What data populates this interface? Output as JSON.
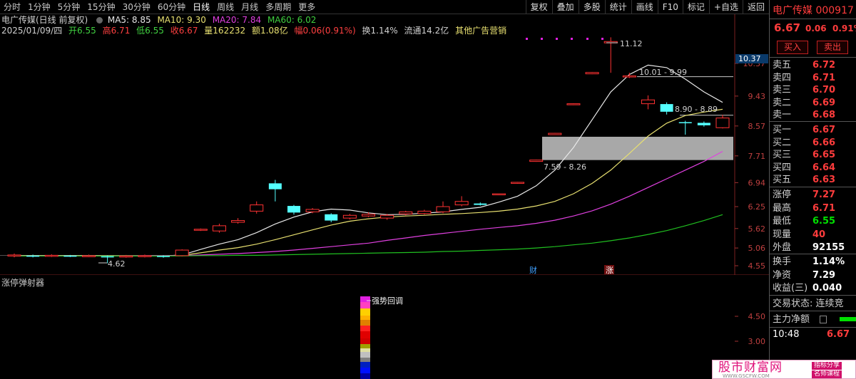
{
  "toolbar": {
    "periods": [
      "分时",
      "1分钟",
      "5分钟",
      "15分钟",
      "30分钟",
      "60分钟",
      "日线",
      "周线",
      "月线",
      "多周期",
      "更多"
    ],
    "active_period": "日线",
    "actions": [
      "复权",
      "叠加",
      "多股",
      "统计",
      "画线",
      "F10",
      "标记",
      "+自选",
      "返回"
    ]
  },
  "info": {
    "title": "电广传媒(日线 前复权)",
    "ma5": "MA5: 8.85",
    "ma10": "MA10: 9.30",
    "ma20": "MA20: 7.84",
    "ma60": "MA60: 6.02",
    "date": "2025/01/09/四",
    "open": "开6.55",
    "high": "高6.71",
    "low": "低6.55",
    "close": "收6.67",
    "volume": "量162232",
    "amount": "额1.08亿",
    "change": "幅0.06(0.91%)",
    "turnover": "换1.14%",
    "float": "流通14.2亿",
    "sector": "其他广告营销"
  },
  "chart_data": {
    "type": "candlestick",
    "yaxis_ticks": [
      "10.37",
      "9.43",
      "8.57",
      "7.71",
      "6.94",
      "6.25",
      "5.62",
      "5.06",
      "4.55"
    ],
    "current_price_label": "10.37",
    "candles": [
      {
        "o": 4.83,
        "c": 4.86,
        "h": 4.9,
        "l": 4.79
      },
      {
        "o": 4.84,
        "c": 4.82,
        "h": 4.87,
        "l": 4.79
      },
      {
        "o": 4.82,
        "c": 4.85,
        "h": 4.88,
        "l": 4.8
      },
      {
        "o": 4.84,
        "c": 4.83,
        "h": 4.86,
        "l": 4.8
      },
      {
        "o": 4.83,
        "c": 4.84,
        "h": 4.87,
        "l": 4.8
      },
      {
        "o": 4.82,
        "c": 4.8,
        "h": 4.84,
        "l": 4.62
      },
      {
        "o": 4.8,
        "c": 4.83,
        "h": 4.86,
        "l": 4.78
      },
      {
        "o": 4.82,
        "c": 4.84,
        "h": 4.87,
        "l": 4.79
      },
      {
        "o": 4.83,
        "c": 4.81,
        "h": 4.85,
        "l": 4.78
      },
      {
        "o": 4.84,
        "c": 5.0,
        "h": 5.02,
        "l": 4.82
      },
      {
        "o": 5.57,
        "c": 5.6,
        "h": 5.62,
        "l": 5.55
      },
      {
        "o": 5.55,
        "c": 5.7,
        "h": 5.76,
        "l": 5.5
      },
      {
        "o": 5.8,
        "c": 5.85,
        "h": 5.92,
        "l": 5.76
      },
      {
        "o": 6.12,
        "c": 6.3,
        "h": 6.4,
        "l": 6.05
      },
      {
        "o": 6.92,
        "c": 6.75,
        "h": 7.02,
        "l": 6.4
      },
      {
        "o": 6.27,
        "c": 6.08,
        "h": 6.3,
        "l": 6.02
      },
      {
        "o": 6.1,
        "c": 6.17,
        "h": 6.21,
        "l": 6.06
      },
      {
        "o": 6.03,
        "c": 5.85,
        "h": 6.06,
        "l": 5.8
      },
      {
        "o": 5.92,
        "c": 6.0,
        "h": 6.04,
        "l": 5.88
      },
      {
        "o": 5.98,
        "c": 6.03,
        "h": 6.09,
        "l": 5.95
      },
      {
        "o": 5.92,
        "c": 6.0,
        "h": 6.04,
        "l": 5.87
      },
      {
        "o": 6.04,
        "c": 6.1,
        "h": 6.13,
        "l": 6.0
      },
      {
        "o": 6.05,
        "c": 6.12,
        "h": 6.16,
        "l": 6.02
      },
      {
        "o": 6.1,
        "c": 6.25,
        "h": 6.4,
        "l": 6.06
      },
      {
        "o": 6.3,
        "c": 6.4,
        "h": 6.55,
        "l": 6.26
      },
      {
        "o": 6.34,
        "c": 6.3,
        "h": 6.37,
        "l": 6.28
      },
      {
        "o": 6.59,
        "c": 6.62,
        "h": 6.63,
        "l": 6.58
      },
      {
        "o": 6.92,
        "c": 6.95,
        "h": 6.96,
        "l": 6.91
      },
      {
        "o": 7.55,
        "c": 7.59,
        "h": 7.6,
        "l": 7.54
      },
      {
        "o": 8.32,
        "c": 8.36,
        "h": 8.37,
        "l": 8.31
      },
      {
        "o": 9.18,
        "c": 9.21,
        "h": 9.22,
        "l": 9.17
      },
      {
        "o": 10.07,
        "c": 10.11,
        "h": 10.12,
        "l": 10.06
      },
      {
        "o": 10.96,
        "c": 11.0,
        "h": 11.12,
        "l": 10.1
      },
      {
        "o": 9.99,
        "c": 10.01,
        "h": 10.1,
        "l": 9.95
      },
      {
        "o": 9.21,
        "c": 9.32,
        "h": 9.45,
        "l": 9.05
      },
      {
        "o": 9.2,
        "c": 8.98,
        "h": 9.25,
        "l": 8.9
      },
      {
        "o": 8.68,
        "c": 8.65,
        "h": 8.72,
        "l": 8.32
      },
      {
        "o": 8.66,
        "c": 8.59,
        "h": 8.7,
        "l": 8.55
      },
      {
        "o": 8.52,
        "c": 8.8,
        "h": 8.89,
        "l": 8.5
      }
    ],
    "ma_lines": [
      {
        "name": "MA5",
        "color": "#e8e8e8",
        "values": [
          4.84,
          4.84,
          4.84,
          4.84,
          4.84,
          4.83,
          4.83,
          4.83,
          4.83,
          4.86,
          5.02,
          5.17,
          5.3,
          5.5,
          5.75,
          5.95,
          6.1,
          6.18,
          6.15,
          6.07,
          6.02,
          6.03,
          6.06,
          6.1,
          6.17,
          6.23,
          6.38,
          6.55,
          6.85,
          7.3,
          7.95,
          8.75,
          9.55,
          10.05,
          10.32,
          10.25,
          9.92,
          9.55,
          9.25
        ]
      },
      {
        "name": "MA10",
        "color": "#e8e070",
        "values": [
          4.84,
          4.84,
          4.84,
          4.84,
          4.84,
          4.84,
          4.84,
          4.84,
          4.84,
          4.85,
          4.92,
          5.0,
          5.07,
          5.17,
          5.3,
          5.44,
          5.58,
          5.72,
          5.83,
          5.9,
          5.95,
          5.98,
          6.0,
          6.03,
          6.05,
          6.08,
          6.12,
          6.18,
          6.27,
          6.4,
          6.62,
          6.92,
          7.3,
          7.78,
          8.28,
          8.65,
          8.87,
          8.97,
          9.05
        ]
      },
      {
        "name": "MA20",
        "color": "#e040e0",
        "values": [
          4.83,
          4.83,
          4.83,
          4.83,
          4.83,
          4.83,
          4.83,
          4.84,
          4.84,
          4.84,
          4.86,
          4.88,
          4.9,
          4.93,
          4.96,
          5.0,
          5.05,
          5.1,
          5.15,
          5.2,
          5.28,
          5.35,
          5.42,
          5.48,
          5.54,
          5.6,
          5.65,
          5.7,
          5.77,
          5.86,
          5.98,
          6.13,
          6.32,
          6.55,
          6.8,
          7.05,
          7.3,
          7.55,
          7.84
        ]
      },
      {
        "name": "MA60",
        "color": "#20c020",
        "values": [
          4.83,
          4.83,
          4.83,
          4.83,
          4.83,
          4.83,
          4.83,
          4.83,
          4.83,
          4.83,
          4.84,
          4.84,
          4.85,
          4.85,
          4.86,
          4.87,
          4.88,
          4.89,
          4.9,
          4.91,
          4.92,
          4.93,
          4.94,
          4.96,
          4.97,
          4.99,
          5.01,
          5.03,
          5.06,
          5.1,
          5.15,
          5.2,
          5.27,
          5.35,
          5.45,
          5.56,
          5.7,
          5.85,
          6.02
        ]
      }
    ],
    "annotations": [
      {
        "text": "11.12",
        "kind": "high"
      },
      {
        "text": "4.62",
        "kind": "low"
      },
      {
        "text": "10.01 - 9.99",
        "kind": "gap"
      },
      {
        "text": "8.90 - 8.89",
        "kind": "gap"
      },
      {
        "text": "7.59 - 8.26",
        "kind": "gap-zone"
      }
    ],
    "markers": [
      "财",
      "涨"
    ]
  },
  "indicator": {
    "title": "涨停弹射器",
    "label": "强势回调",
    "ticks": [
      "4.50",
      "3.00"
    ]
  },
  "panel": {
    "stock_name": "电广传媒",
    "code": "000917",
    "price": "6.67",
    "change": "0.06",
    "change_pct": "0.91%",
    "buy_btn": "买入",
    "sell_btn": "卖出",
    "asks": [
      {
        "label": "卖五",
        "price": "6.72"
      },
      {
        "label": "卖四",
        "price": "6.71"
      },
      {
        "label": "卖三",
        "price": "6.70"
      },
      {
        "label": "卖二",
        "price": "6.69"
      },
      {
        "label": "卖一",
        "price": "6.68"
      }
    ],
    "bids": [
      {
        "label": "买一",
        "price": "6.67"
      },
      {
        "label": "买二",
        "price": "6.66"
      },
      {
        "label": "买三",
        "price": "6.65"
      },
      {
        "label": "买四",
        "price": "6.64"
      },
      {
        "label": "买五",
        "price": "6.63"
      }
    ],
    "stats": [
      {
        "label": "涨停",
        "value": "7.27",
        "color": "red"
      },
      {
        "label": "最高",
        "value": "6.71",
        "color": "red"
      },
      {
        "label": "最低",
        "value": "6.55",
        "color": "green"
      },
      {
        "label": "现量",
        "value": "40",
        "color": "red"
      },
      {
        "label": "外盘",
        "value": "92155",
        "color": "white"
      }
    ],
    "stats2": [
      {
        "label": "换手",
        "value": "1.14%"
      },
      {
        "label": "净资",
        "value": "7.29"
      },
      {
        "label": "收益(三)",
        "value": "0.040"
      }
    ],
    "trade_status": "交易状态: 连续竞",
    "main_flow": "主力净额",
    "last_time": "10:48",
    "last_price": "6.67"
  },
  "watermark": {
    "title": "股市财富网",
    "url": "WWW.GSCFW.COM",
    "tag1": "指标分享",
    "tag2": "名师课程"
  }
}
